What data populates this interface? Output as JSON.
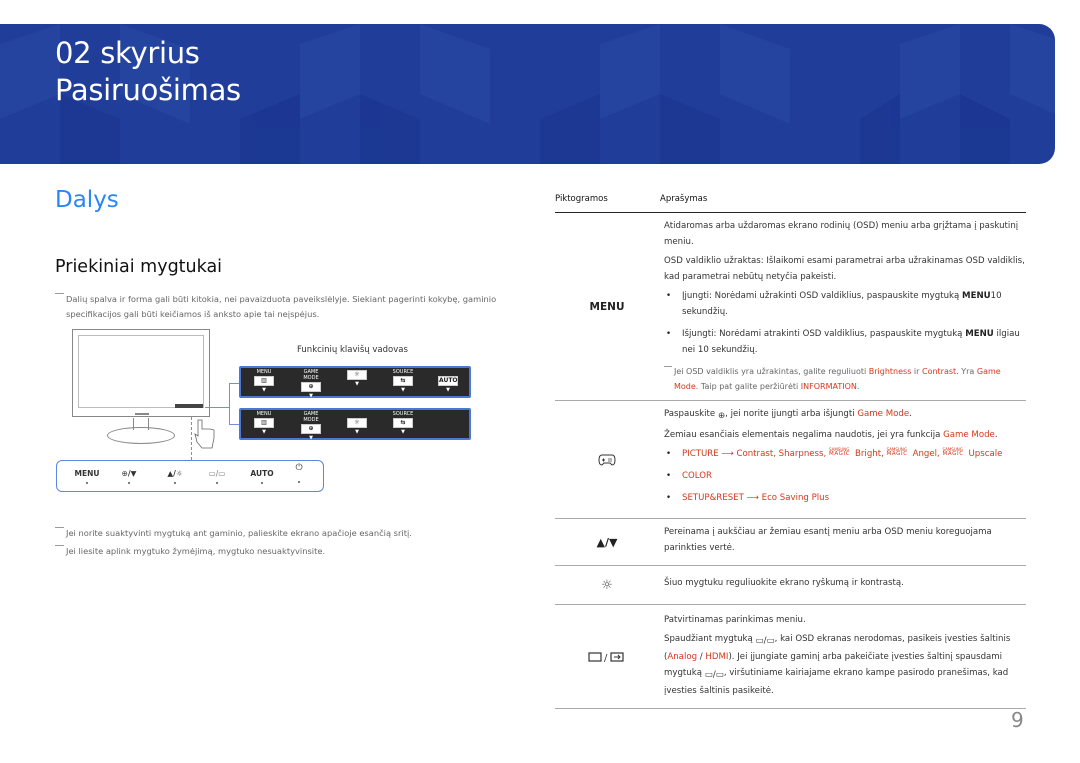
{
  "banner": {
    "chapter": "02 skyrius",
    "title": "Pasiruošimas",
    "color": "#1f3d99"
  },
  "section": {
    "title": "Dalys",
    "title_color": "#2a86f5",
    "subtitle": "Priekiniai mygtukai"
  },
  "notes": {
    "top": "Dalių spalva ir forma gali būti kitokia, nei pavaizduota paveikslėlyje. Siekiant pagerinti kokybę, gaminio specifikacijos gali būti keičiamos iš anksto apie tai neįspėjus.",
    "bottom": [
      "Jei norite suaktyvinti mygtuką ant gaminio, palieskite ekrano apačioje esančią sritį.",
      "Jei liesite aplink mygtuko žymėjimą, mygtuko nesuaktyvinsite."
    ]
  },
  "diagram": {
    "function_key_guide": "Funkcinių klavišų vadovas",
    "panel1_keys": [
      {
        "label": "MENU",
        "icon": "menu-grid-icon"
      },
      {
        "label": "GAME MODE",
        "icon": "gamepad-icon"
      },
      {
        "label": "",
        "icon": "brightness-icon"
      },
      {
        "label": "SOURCE",
        "icon": "source-icon"
      },
      {
        "label": "",
        "icon": "auto-icon",
        "box_text": "AUTO"
      }
    ],
    "panel2_keys": [
      {
        "label": "MENU",
        "icon": "menu-grid-icon"
      },
      {
        "label": "GAME MODE",
        "icon": "gamepad-icon"
      },
      {
        "label": "",
        "icon": "brightness-icon"
      },
      {
        "label": "SOURCE",
        "icon": "source-icon"
      }
    ],
    "front_buttons": [
      {
        "label": "MENU"
      },
      {
        "label": "/▼",
        "icon": "gamepad-icon"
      },
      {
        "label": "▲/",
        "icon": "brightness-icon"
      },
      {
        "label": "/",
        "icon": "source-icon"
      },
      {
        "label": "AUTO"
      },
      {
        "label": "",
        "icon": "power-icon"
      }
    ]
  },
  "table": {
    "headers": [
      "Piktogramos",
      "Aprašymas"
    ],
    "rows": [
      {
        "icon_label": "MENU",
        "p1": "Atidaromas arba uždaromas ekrano rodinių (OSD) meniu arba grįžtama į paskutinį meniu.",
        "p2": "OSD valdiklio užraktas: Išlaikomi esami parametrai arba užrakinamas OSD valdiklis, kad parametrai nebūtų netyčia pakeisti.",
        "bullet1_pre": "Įjungti: Norėdami užrakinti OSD valdiklius, paspauskite mygtuką ",
        "bullet1_bold": "MENU",
        "bullet1_post": "10 sekundžių.",
        "bullet2_pre": "Išjungti: Norėdami atrakinti OSD valdiklius, paspauskite mygtuką ",
        "bullet2_bold": "MENU",
        "bullet2_post": " ilgiau nei 10 sekundžių.",
        "note_a": "Jei OSD valdiklis yra užrakintas, galite reguliuoti ",
        "note_brightness": "Brightness",
        "note_b": " ir ",
        "note_contrast": "Contrast",
        "note_c": ". Yra ",
        "note_game": "Game Mode",
        "note_d": ". Taip pat galite peržiūrėti ",
        "note_info": "INFORMATION",
        "note_e": "."
      },
      {
        "icon": "gamepad-icon",
        "p1_a": "Paspauskite ",
        "p1_b": ", jei norite įjungti arba išjungti ",
        "p1_red": "Game Mode",
        "p1_c": ".",
        "p2_a": "Žemiau esančiais elementais negalima naudotis, jei yra funkcija ",
        "p2_red": "Game Mode",
        "p2_b": ".",
        "bullet1": {
          "picture": "PICTURE",
          "arrow": " ⟶ ",
          "contrast": "Contrast",
          "sharpness": "Sharpness",
          "magic_small_top": "SAMSUNG",
          "magic_small_bottom": "MAGIC",
          "bright": "Bright",
          "angel": "Angel",
          "upscale": "Upscale"
        },
        "bullet2": "COLOR",
        "bullet3_a": "SETUP&RESET",
        "bullet3_arrow": " ⟶ ",
        "bullet3_b": "Eco Saving Plus"
      },
      {
        "icon_label": "▲/▼",
        "desc": "Pereinama į aukščiau ar žemiau esantį meniu arba OSD meniu koreguojama parinkties vertė."
      },
      {
        "icon": "brightness-icon",
        "desc": "Šiuo mygtuku reguliuokite ekrano ryškumą ir kontrastą."
      },
      {
        "icon": "source-icon",
        "icon_sep": "/",
        "p1": "Patvirtinamas parinkimas meniu.",
        "p2_a": "Spaudžiant mygtuką ",
        "p2_b": ", kai OSD ekranas nerodomas, pasikeis įvesties šaltinis (",
        "p2_analog": "Analog",
        "p2_sep": " / ",
        "p2_hdmi": "HDMI",
        "p2_c": "). Jei įjungiate gaminį arba pakeičiate įvesties šaltinį spausdami mygtuką ",
        "p2_d": ", viršutiniame kairiajame ekrano kampe pasirodo pranešimas, kad įvesties šaltinis pasikeitė."
      }
    ],
    "accent_color": "#d4381b"
  },
  "page_number": "9"
}
